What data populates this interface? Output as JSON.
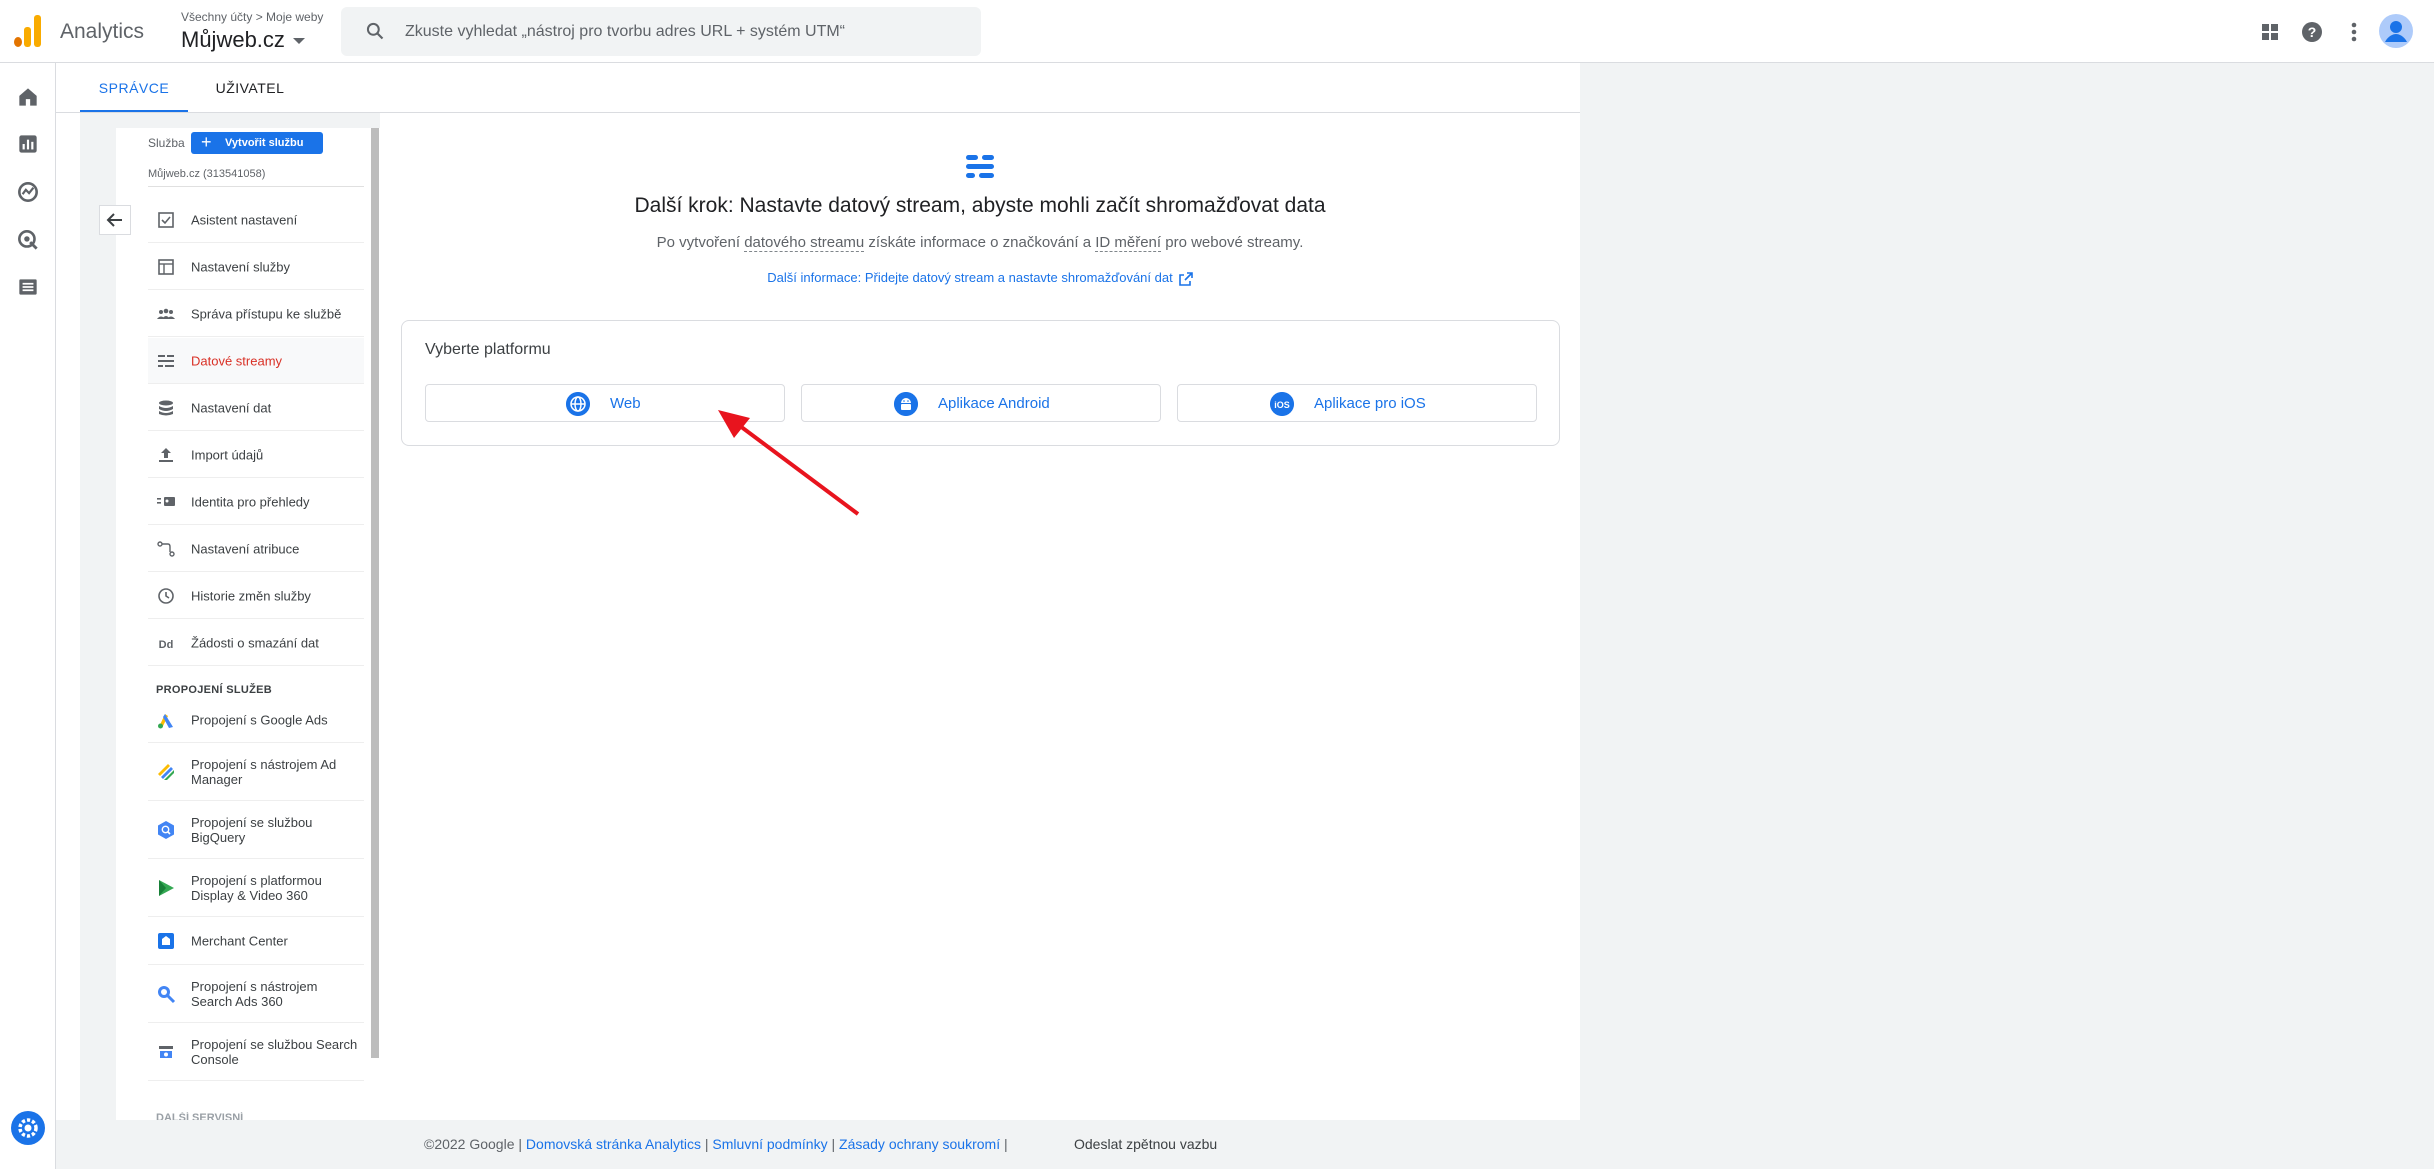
{
  "app": {
    "name": "Analytics"
  },
  "header": {
    "breadcrumb": "Všechny účty > Moje weby",
    "property": "Můjweb.cz",
    "search_placeholder": "Zkuste vyhledat „nástroj pro tvorbu adres URL + systém UTM“"
  },
  "tabs": [
    {
      "label": "SPRÁVCE",
      "active": true
    },
    {
      "label": "UŽIVATEL",
      "active": false
    }
  ],
  "admin": {
    "service_label": "Služba",
    "create_button": "Vytvořit službu",
    "service_name": "Můjweb.cz (313541058)",
    "items": [
      {
        "label": "Asistent nastavení",
        "icon": "checkbox-icon"
      },
      {
        "label": "Nastavení služby",
        "icon": "layout-icon"
      },
      {
        "label": "Správa přístupu ke službě",
        "icon": "people-icon"
      },
      {
        "label": "Datové streamy",
        "icon": "streams-icon",
        "active": true
      },
      {
        "label": "Nastavení dat",
        "icon": "database-icon"
      },
      {
        "label": "Import údajů",
        "icon": "upload-icon"
      },
      {
        "label": "Identita pro přehledy",
        "icon": "identity-icon"
      },
      {
        "label": "Nastavení atribuce",
        "icon": "attribution-icon"
      },
      {
        "label": "Historie změn služby",
        "icon": "history-icon"
      },
      {
        "label": "Žádosti o smazání dat",
        "icon": "dd-icon"
      }
    ],
    "links_heading": "PROPOJENÍ SLUŽEB",
    "links": [
      {
        "label": "Propojení s Google Ads",
        "icon": "google-ads-icon"
      },
      {
        "label": "Propojení s nástrojem Ad Manager",
        "icon": "ad-manager-icon"
      },
      {
        "label": "Propojení se službou BigQuery",
        "icon": "bigquery-icon"
      },
      {
        "label": "Propojení s platformou Display & Video 360",
        "icon": "dv360-icon"
      },
      {
        "label": "Merchant Center",
        "icon": "merchant-center-icon"
      },
      {
        "label": "Propojení s nástrojem Search Ads 360",
        "icon": "search-ads-icon"
      },
      {
        "label": "Propojení se službou Search Console",
        "icon": "search-console-icon"
      }
    ],
    "more_heading": "DALŠÍ SERVISNÍ"
  },
  "content": {
    "title": "Další krok: Nastavte datový stream, abyste mohli začít shromažďovat data",
    "sub_1": "Po vytvoření ",
    "sub_link_1": "datového streamu",
    "sub_2": " získáte informace o značkování a ",
    "sub_link_2": "ID měření",
    "sub_3": " pro webové streamy.",
    "help_link": "Další informace: Přidejte datový stream a nastavte shromažďování dat",
    "platform_title": "Vyberte platformu",
    "platforms": [
      {
        "label": "Web",
        "icon": "globe-icon"
      },
      {
        "label": "Aplikace Android",
        "icon": "android-icon"
      },
      {
        "label": "Aplikace pro iOS",
        "icon": "ios-icon"
      }
    ]
  },
  "footer": {
    "copyright": "©2022 Google | ",
    "links": [
      "Domovská stránka Analytics",
      "Smluvní podmínky",
      "Zásady ochrany soukromí"
    ],
    "sep": " | ",
    "feedback": "Odeslat zpětnou vazbu"
  },
  "colors": {
    "accent": "#1a73e8",
    "active_nav": "#d93025",
    "annotation_arrow": "#e8141e"
  }
}
